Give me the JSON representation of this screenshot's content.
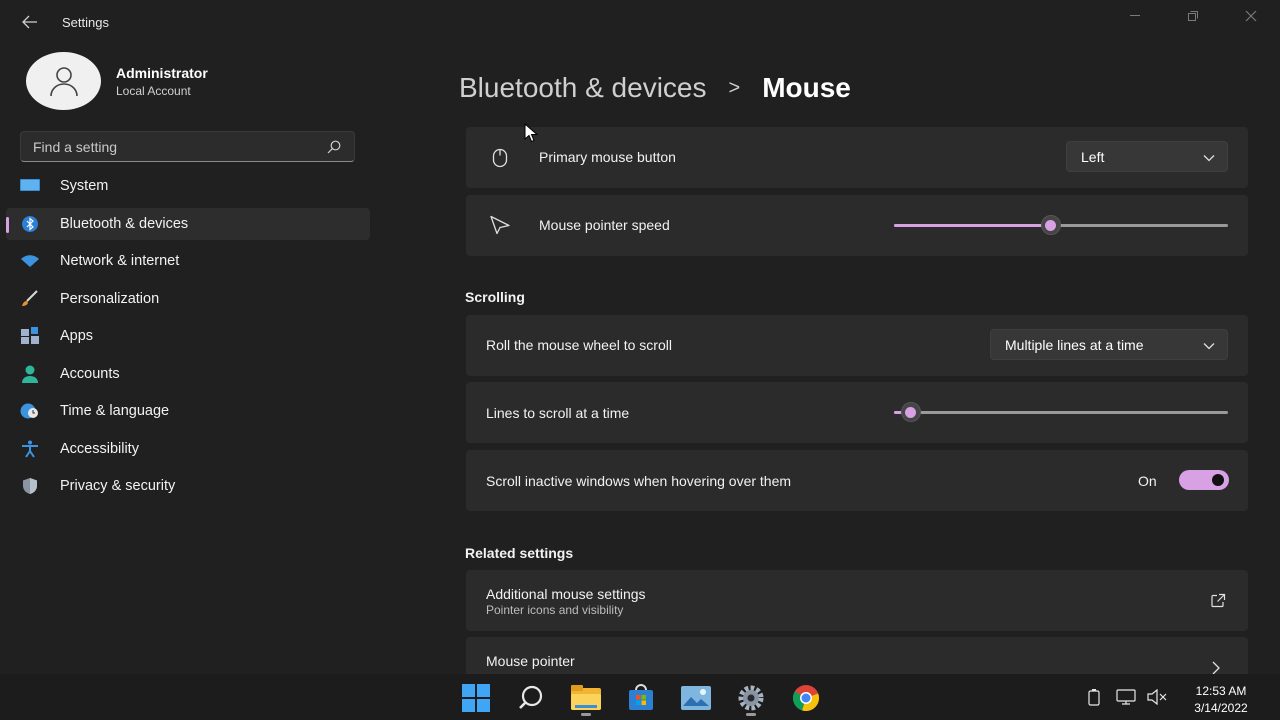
{
  "window": {
    "title": "Settings",
    "back_icon": "back-arrow-icon",
    "controls": [
      "minimize-icon",
      "maximize-icon",
      "close-icon"
    ]
  },
  "profile": {
    "name": "Administrator",
    "account_type": "Local Account"
  },
  "search": {
    "placeholder": "Find a setting"
  },
  "sidebar": {
    "items": [
      {
        "label": "System",
        "icon": "system-monitor-icon"
      },
      {
        "label": "Bluetooth & devices",
        "icon": "bluetooth-icon",
        "active": true
      },
      {
        "label": "Network & internet",
        "icon": "wifi-icon"
      },
      {
        "label": "Personalization",
        "icon": "brush-icon"
      },
      {
        "label": "Apps",
        "icon": "apps-icon"
      },
      {
        "label": "Accounts",
        "icon": "accounts-icon"
      },
      {
        "label": "Time & language",
        "icon": "globe-clock-icon"
      },
      {
        "label": "Accessibility",
        "icon": "accessibility-icon"
      },
      {
        "label": "Privacy & security",
        "icon": "shield-icon"
      }
    ]
  },
  "breadcrumb": {
    "parent": "Bluetooth & devices",
    "separator": ">",
    "current": "Mouse"
  },
  "settings": {
    "primary_button": {
      "label": "Primary mouse button",
      "value": "Left"
    },
    "pointer_speed": {
      "label": "Mouse pointer speed",
      "value_fraction": 0.47
    },
    "scrolling_header": "Scrolling",
    "roll_wheel": {
      "label": "Roll the mouse wheel to scroll",
      "value": "Multiple lines at a time"
    },
    "lines_to_scroll": {
      "label": "Lines to scroll at a time",
      "value_fraction": 0.05
    },
    "scroll_inactive": {
      "label": "Scroll inactive windows when hovering over them",
      "state": "On",
      "on": true
    },
    "related_header": "Related settings",
    "additional": {
      "label": "Additional mouse settings",
      "sub": "Pointer icons and visibility"
    },
    "mouse_pointer": {
      "label": "Mouse pointer"
    }
  },
  "taskbar": {
    "apps": [
      "start-icon",
      "search-icon",
      "file-explorer-icon",
      "store-icon",
      "photos-icon",
      "settings-gear-icon",
      "chrome-icon"
    ],
    "tray": [
      "battery-icon",
      "network-icon",
      "volume-muted-icon"
    ],
    "time": "12:53 AM",
    "date": "3/14/2022"
  },
  "colors": {
    "accent": "#d7a1e3",
    "background": "#202020",
    "card": "#2b2b2b"
  }
}
